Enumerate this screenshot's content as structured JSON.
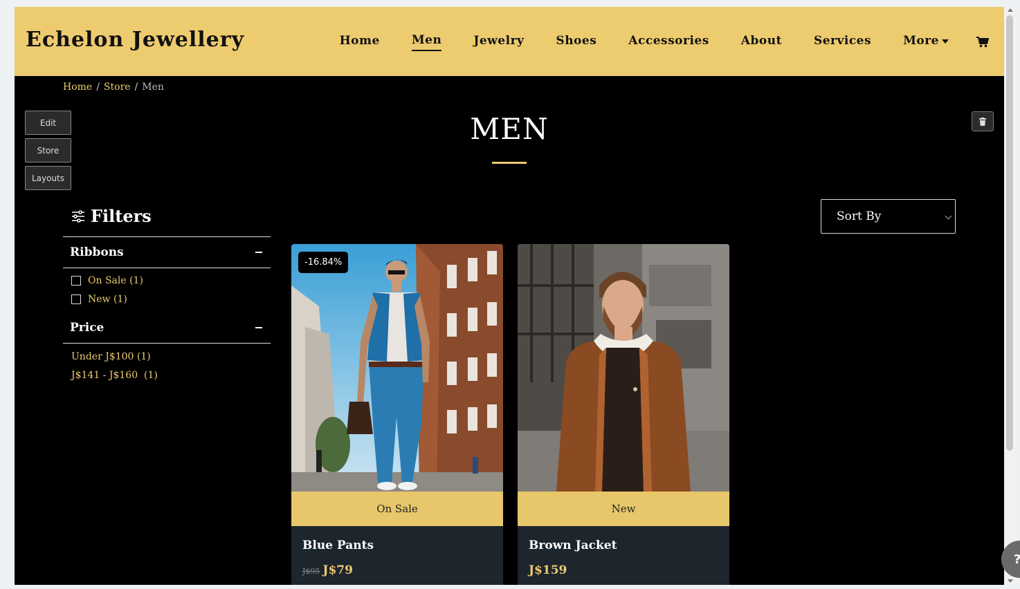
{
  "header": {
    "brand": "Echelon Jewellery",
    "nav": [
      {
        "label": "Home",
        "active": false
      },
      {
        "label": "Men",
        "active": true
      },
      {
        "label": "Jewelry",
        "active": false
      },
      {
        "label": "Shoes",
        "active": false
      },
      {
        "label": "Accessories",
        "active": false
      },
      {
        "label": "About",
        "active": false
      },
      {
        "label": "Services",
        "active": false
      },
      {
        "label": "More",
        "active": false
      }
    ],
    "cart_icon": "shopping-cart-icon"
  },
  "breadcrumb": {
    "home": "Home",
    "store": "Store",
    "current": "Men",
    "separator": "/"
  },
  "admin": {
    "edit": "Edit",
    "store": "Store",
    "layouts": "Layouts",
    "delete_icon": "trash-icon"
  },
  "page": {
    "title": "MEN"
  },
  "filters": {
    "heading": "Filters",
    "ribbons": {
      "title": "Ribbons",
      "options": [
        "On Sale (1)",
        "New (1)"
      ]
    },
    "price": {
      "title": "Price",
      "options": [
        "Under J$100 (1)",
        "J$141 - J$160  (1)"
      ]
    }
  },
  "sort": {
    "label": "Sort By"
  },
  "products": [
    {
      "name": "Blue Pants",
      "ribbon": "On Sale",
      "discount": "-16.84%",
      "old_price": "J$95",
      "price": "J$79"
    },
    {
      "name": "Brown Jacket",
      "ribbon": "New",
      "price": "J$159"
    }
  ],
  "help": {
    "label": "?"
  },
  "colors": {
    "accent": "#edcb6f",
    "background": "#000000",
    "card": "#1d252d"
  }
}
